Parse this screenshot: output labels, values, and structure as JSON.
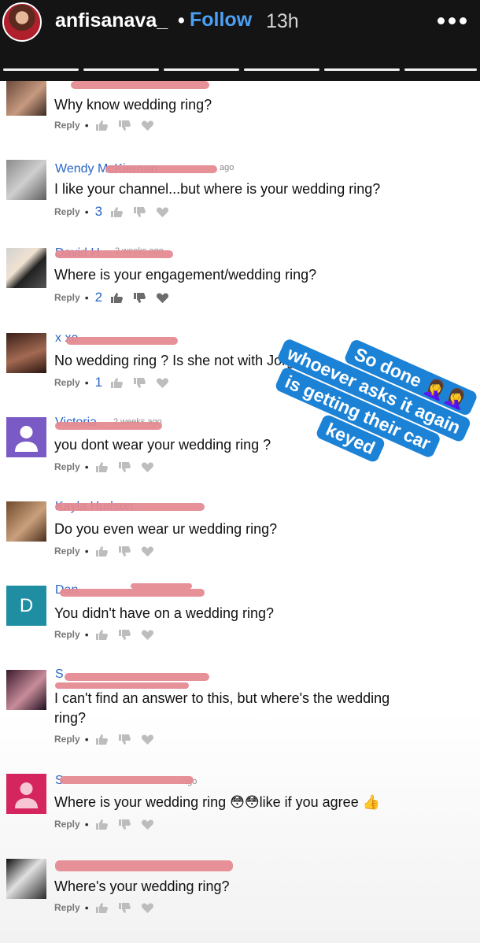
{
  "story": {
    "username": "anfisanava_",
    "separator": "•",
    "follow_label": "Follow",
    "time_ago": "13h",
    "progress_segments": 6
  },
  "comments": [
    {
      "text": "Why know wedding ring?",
      "reply_label": "Reply",
      "dot": "•",
      "likes": ""
    },
    {
      "author": "Wendy McKiernan",
      "meta": "ago",
      "text": "I like your channel...but where is your wedding ring?",
      "reply_label": "Reply",
      "dot": "•",
      "likes": "3"
    },
    {
      "author": "David H",
      "meta": "2 weeks ago",
      "text": "Where is your engagement/wedding ring?",
      "reply_label": "Reply",
      "dot": "•",
      "likes": "2"
    },
    {
      "author": "x xo",
      "text": "No wedding ring ? Is she not with Jorge",
      "reply_label": "Reply",
      "dot": "•",
      "likes": "1"
    },
    {
      "author": "Victoria",
      "meta": "2 weeks ago",
      "text": "you dont wear your wedding ring ?",
      "reply_label": "Reply",
      "dot": "•",
      "likes": ""
    },
    {
      "author": "Kayla Hudson",
      "text": "Do you even wear ur wedding ring?",
      "reply_label": "Reply",
      "dot": "•",
      "likes": ""
    },
    {
      "author": "Dan",
      "avatar_letter": "D",
      "text": "You didn't have on a wedding ring?",
      "reply_label": "Reply",
      "dot": "•",
      "likes": ""
    },
    {
      "author": "S",
      "text_line1": "I can't find an answer to this, but where's the wedding",
      "text_line2": "ring?",
      "reply_label": "Reply",
      "dot": "•",
      "likes": ""
    },
    {
      "author": "S",
      "meta": "ago",
      "text": "Where is your wedding ring 😳😳like if you agree 👍",
      "reply_label": "Reply",
      "dot": "•",
      "likes": ""
    },
    {
      "author": "",
      "text": "Where's your wedding ring?",
      "reply_label": "Reply",
      "dot": "•",
      "likes": ""
    }
  ],
  "sticker": {
    "lines": [
      "So done 🤦‍♀️🤦‍♀️",
      "whoever asks it again",
      "is getting their car",
      "keyed"
    ],
    "color": "#1b82d6"
  },
  "colors": {
    "header_bg": "#141414",
    "follow": "#4aa0f5",
    "author": "#2a66c5",
    "redaction": "#e58a92"
  }
}
